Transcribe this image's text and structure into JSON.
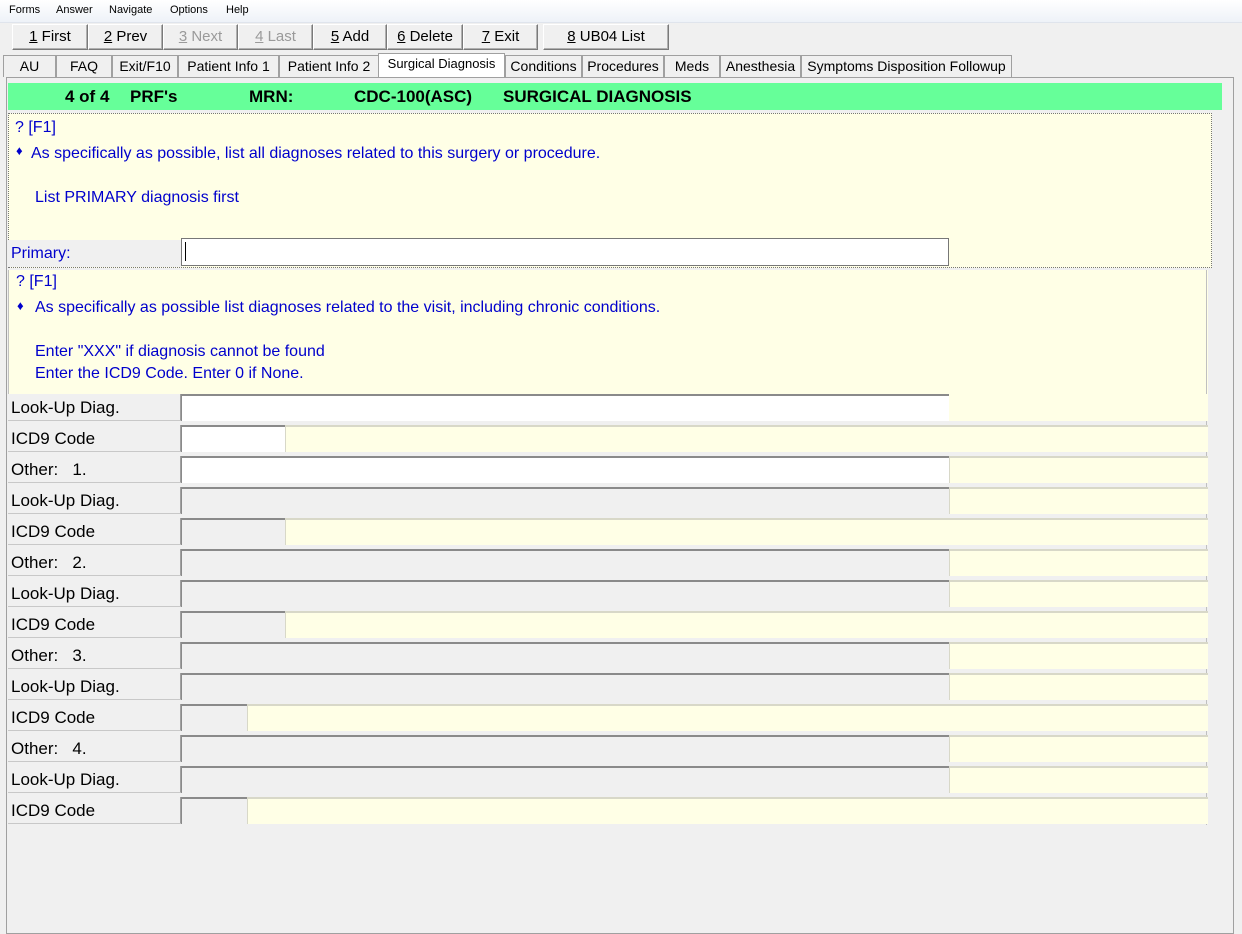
{
  "menu": [
    "Forms",
    "Answer",
    "Navigate",
    "Options",
    "Help"
  ],
  "toolbar": [
    {
      "key": "1",
      "label": " First",
      "enabled": true
    },
    {
      "key": "2",
      "label": " Prev",
      "enabled": true
    },
    {
      "key": "3",
      "label": " Next",
      "enabled": false
    },
    {
      "key": "4",
      "label": " Last",
      "enabled": false
    },
    {
      "key": "5",
      "label": " Add",
      "enabled": true
    },
    {
      "key": "6",
      "label": " Delete",
      "enabled": true
    },
    {
      "key": "7",
      "label": " Exit",
      "enabled": true
    },
    {
      "key": "8",
      "label": " UB04 List",
      "enabled": true
    }
  ],
  "tabs": [
    "AU",
    "FAQ",
    "Exit/F10",
    "Patient Info 1",
    "Patient Info 2",
    "Surgical Diagnosis",
    "Conditions",
    "Procedures",
    "Meds",
    "Anesthesia",
    "Symptoms Disposition Followup"
  ],
  "active_tab": "Surgical Diagnosis",
  "header": {
    "record": "4 of 4",
    "prf": "PRF's",
    "mrn_label": "MRN:",
    "mrn_value": "CDC-100(ASC)",
    "section": "SURGICAL DIAGNOSIS"
  },
  "info1": {
    "help": "? [F1]",
    "bullet": "♦",
    "line1": "As specifically as possible, list all diagnoses related to this surgery or procedure.",
    "line2": "List PRIMARY diagnosis first"
  },
  "primary": {
    "label": "Primary:",
    "value": ""
  },
  "info2": {
    "help": "? [F1]",
    "bullet": "♦",
    "line1": "As specifically as possible list diagnoses related to the visit, including chronic conditions.",
    "line2": "Enter \"XXX\" if diagnosis cannot be found",
    "line3": "Enter the ICD9 Code. Enter 0 if None."
  },
  "rows": [
    {
      "label": "Look-Up Diag.",
      "value": "",
      "state": "enabled"
    },
    {
      "label": "ICD9 Code",
      "value": "",
      "state": "enabled"
    },
    {
      "label": "Other:   1.",
      "value": "",
      "state": "enabled"
    },
    {
      "label": "Look-Up Diag.",
      "value": "",
      "state": "disabled"
    },
    {
      "label": "ICD9 Code",
      "value": "",
      "state": "disabled"
    },
    {
      "label": "Other:   2.",
      "value": "",
      "state": "disabled"
    },
    {
      "label": "Look-Up Diag.",
      "value": "",
      "state": "disabled"
    },
    {
      "label": "ICD9 Code",
      "value": "",
      "state": "disabled"
    },
    {
      "label": "Other:   3.",
      "value": "",
      "state": "disabled"
    },
    {
      "label": "Look-Up Diag.",
      "value": "",
      "state": "disabled"
    },
    {
      "label": "ICD9 Code",
      "value": "",
      "state": "disabled"
    },
    {
      "label": "Other:   4.",
      "value": "",
      "state": "disabled"
    },
    {
      "label": "Look-Up Diag.",
      "value": "",
      "state": "disabled"
    },
    {
      "label": "ICD9 Code",
      "value": "",
      "state": "disabled"
    }
  ],
  "colors": {
    "banner": "#66ff99",
    "info_bg": "#ffffe6",
    "info_text": "#0000cc",
    "panel_bg": "#f0f0f0"
  }
}
